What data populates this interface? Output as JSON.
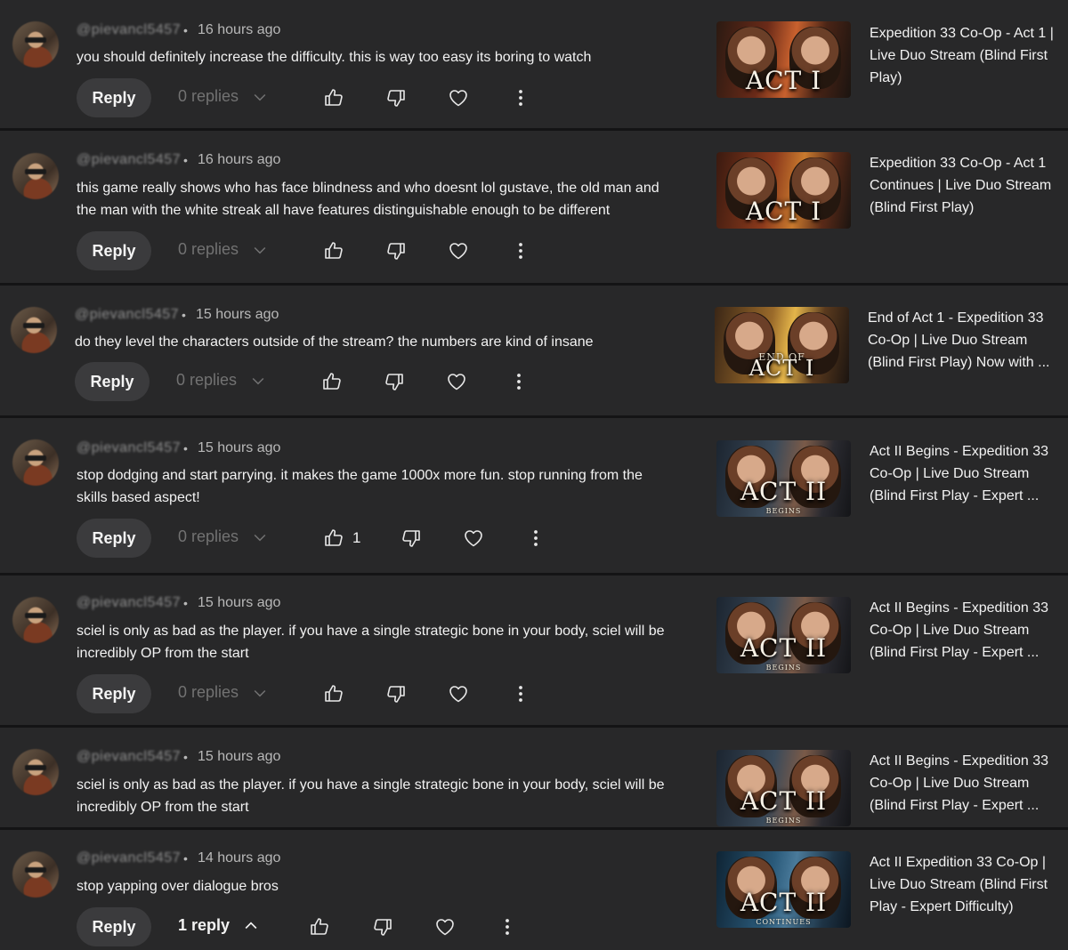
{
  "colors": {
    "background": "#282829",
    "separator": "#141415",
    "button": "#3b3b3d"
  },
  "comments": [
    {
      "handle": "@pievancl5457",
      "time": "16 hours ago",
      "text_lines": [
        "you should definitely increase the difficulty. this is way too easy its boring to watch"
      ],
      "reply_label": "Reply",
      "replies_label": "0 replies",
      "likes": "",
      "video": {
        "title": "Expedition 33 Co-Op - Act 1 | Live Duo Stream (Blind First Play)",
        "thumb_text": "ACT I",
        "thumb_sub": ""
      }
    },
    {
      "handle": "@pievancl5457",
      "time": "16 hours ago",
      "text_lines": [
        "this game really shows who has face blindness and who doesnt lol gustave, the old man and",
        "the man with the white streak all have features distinguishable enough to be different"
      ],
      "reply_label": "Reply",
      "replies_label": "0 replies",
      "likes": "",
      "video": {
        "title": "Expedition 33 Co-Op - Act 1 Continues | Live Duo Stream (Blind First Play)",
        "thumb_text": "ACT I",
        "thumb_sub": ""
      }
    },
    {
      "handle": "@pievancl5457",
      "time": "15 hours ago",
      "text_lines": [
        "do they level the characters outside of the stream? the numbers are kind of insane"
      ],
      "reply_label": "Reply",
      "replies_label": "0 replies",
      "likes": "",
      "video": {
        "title": "End of Act 1 - Expedition 33 Co-Op | Live Duo Stream (Blind First Play) Now with ...",
        "thumb_text": "ACT I",
        "thumb_sub": "END OF"
      }
    },
    {
      "handle": "@pievancl5457",
      "time": "15 hours ago",
      "text_lines": [
        "stop dodging and start parrying. it makes the game 1000x more fun. stop running from the",
        "skills based aspect!"
      ],
      "reply_label": "Reply",
      "replies_label": "0 replies",
      "likes": "1",
      "video": {
        "title": "Act II Begins - Expedition 33 Co-Op | Live Duo Stream (Blind First Play - Expert ...",
        "thumb_text": "ACT II",
        "thumb_sub": "BEGINS"
      }
    },
    {
      "handle": "@pievancl5457",
      "time": "15 hours ago",
      "text_lines": [
        "sciel is only as bad as the player. if you have a single strategic bone in your body, sciel will be",
        "incredibly OP from the start"
      ],
      "reply_label": "Reply",
      "replies_label": "0 replies",
      "likes": "",
      "video": {
        "title": "Act II Begins - Expedition 33 Co-Op | Live Duo Stream (Blind First Play - Expert ...",
        "thumb_text": "ACT II",
        "thumb_sub": "BEGINS"
      }
    },
    {
      "handle": "@pievancl5457",
      "time": "15 hours ago",
      "text_lines": [
        "sciel is only as bad as the player. if you have a single strategic bone in your body, sciel will be",
        "incredibly OP from the start"
      ],
      "reply_label": "",
      "replies_label": "",
      "likes": "",
      "video": {
        "title": "Act II Begins - Expedition 33 Co-Op | Live Duo Stream (Blind First Play - Expert ...",
        "thumb_text": "ACT II",
        "thumb_sub": "BEGINS"
      }
    },
    {
      "handle": "@pievancl5457",
      "time": "14 hours ago",
      "text_lines": [
        "stop yapping over dialogue bros"
      ],
      "reply_label": "Reply",
      "replies_label": "1 reply",
      "likes": "",
      "video": {
        "title": "Act II Expedition 33 Co-Op | Live Duo Stream (Blind First Play - Expert Difficulty)",
        "thumb_text": "ACT II",
        "thumb_sub": "CONTINUES"
      }
    }
  ]
}
